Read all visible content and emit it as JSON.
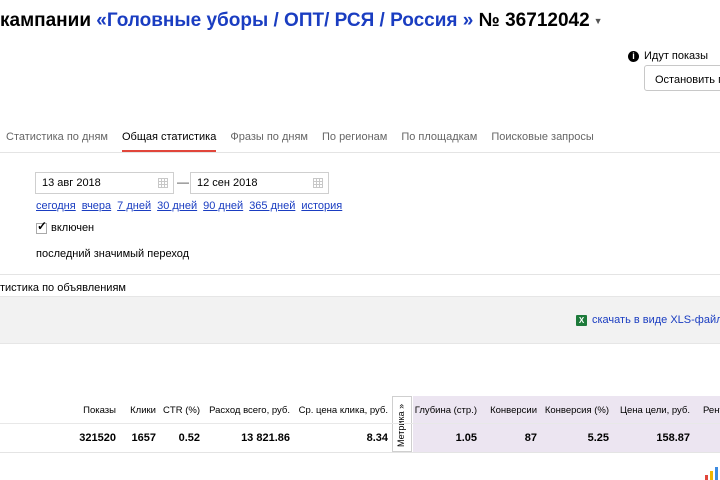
{
  "header": {
    "title_prefix": "кампании ",
    "campaign": "«Головные уборы / ОПТ/ РСЯ / Россия »",
    "number": " № 36712042"
  },
  "status": {
    "text": "Идут показы",
    "stop_button": "Остановить показы"
  },
  "tabs": [
    {
      "label": "Статистика по дням",
      "active": false
    },
    {
      "label": "Общая статистика",
      "active": true
    },
    {
      "label": "Фразы по дням",
      "active": false
    },
    {
      "label": "По регионам",
      "active": false
    },
    {
      "label": "По площадкам",
      "active": false
    },
    {
      "label": "Поисковые запросы",
      "active": false
    }
  ],
  "dates": {
    "from": "13 авг 2018",
    "dash": "—",
    "to": "12 сен 2018"
  },
  "periods": [
    "сегодня",
    "вчера",
    "7 дней",
    "30 дней",
    "90 дней",
    "365 дней",
    "история"
  ],
  "options": {
    "included_label": "включен",
    "included_checked": true,
    "last_click": "последний значимый переход"
  },
  "section": {
    "by_ads": "тистика по объявлениям"
  },
  "download": {
    "label": "скачать в виде XLS-файла",
    "icon": "excel-icon"
  },
  "table": {
    "metrika_label": "Метрика »",
    "headers": {
      "shows": "Показы",
      "clicks": "Клики",
      "ctr": "CTR (%)",
      "spend": "Расход всего, руб.",
      "cpc": "Ср. цена клика, руб.",
      "depth": "Глубина (стр.)",
      "conversions": "Конверсии",
      "conv_rate": "Конверсия (%)",
      "goal_price": "Цена цели, руб.",
      "roi": "Рент"
    },
    "row": {
      "shows": "321520",
      "clicks": "1657",
      "ctr": "0.52",
      "spend": "13 821.86",
      "cpc": "8.34",
      "depth": "1.05",
      "conversions": "87",
      "conv_rate": "5.25",
      "goal_price": "158.87"
    }
  },
  "colors": {
    "link": "#1a3dc1",
    "tab_underline": "#e1463b",
    "metrika_bg": "#ece5f1"
  }
}
